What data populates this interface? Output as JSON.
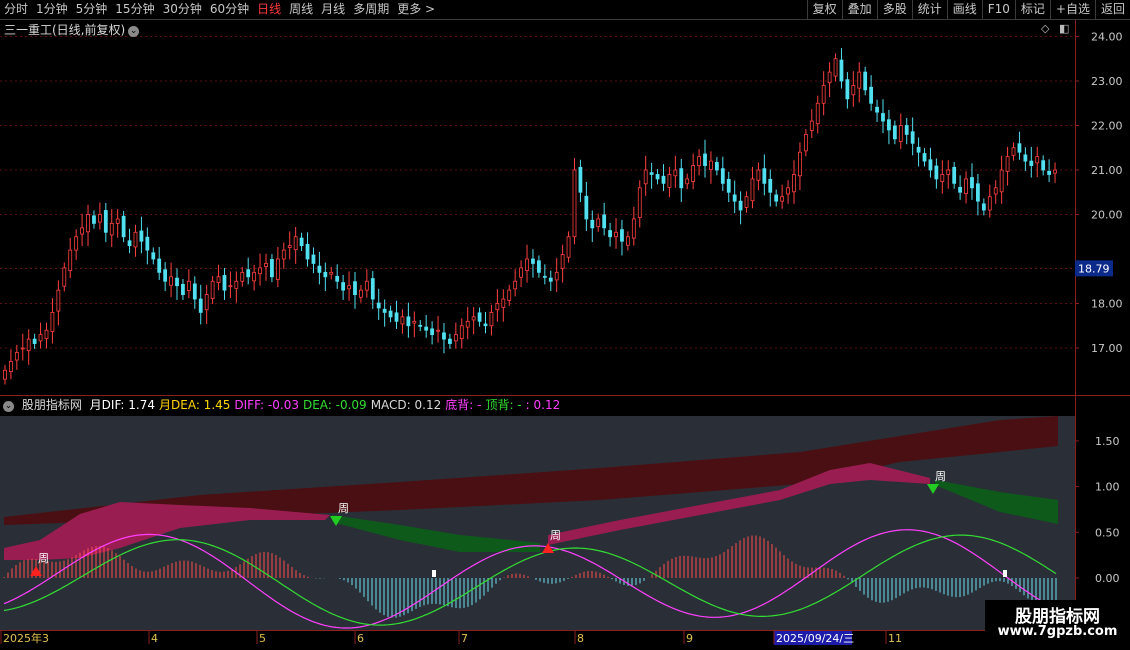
{
  "toolbar": {
    "periods": [
      "分时",
      "1分钟",
      "5分钟",
      "15分钟",
      "30分钟",
      "60分钟",
      "日线",
      "周线",
      "月线",
      "多周期",
      "更多 >"
    ],
    "active_index": 6,
    "tools": [
      "复权",
      "叠加",
      "多股",
      "统计",
      "画线",
      "F10",
      "标记",
      "+自选",
      "返回"
    ]
  },
  "stock": {
    "title": "三一重工(日线,前复权)"
  },
  "price_panel": {
    "icons": [
      "diamond-icon",
      "panel-toggle-icon"
    ],
    "current_price": "18.79"
  },
  "macd_panel": {
    "name": "股朋指标网",
    "items": [
      {
        "text": "月DIF: 1.74",
        "color": "#ffffff"
      },
      {
        "text": "月DEA: 1.45",
        "color": "#ffd700"
      },
      {
        "text": "DIFF: -0.03",
        "color": "#ff40ff"
      },
      {
        "text": "DEA: -0.09",
        "color": "#33dd33"
      },
      {
        "text": "MACD: 0.12",
        "color": "#d8d8d8"
      },
      {
        "text": "底背: -",
        "color": "#ff40ff"
      },
      {
        "text": "顶背: -",
        "color": "#33dd33"
      },
      {
        "text": ": 0.12",
        "color": "#ff40ff"
      }
    ],
    "marker_label": "周"
  },
  "date_axis": {
    "labels": [
      "2025年3",
      "4",
      "5",
      "6",
      "7",
      "8",
      "9",
      "2025/09/24/三",
      "11"
    ],
    "highlight_index": 7
  },
  "watermark": {
    "line1": "股朋指标网",
    "line2": "www.7gpzb.com"
  },
  "chart_data": [
    {
      "type": "candlestick",
      "title": "三一重工(日线,前复权)",
      "ylim": [
        16.55,
        24.35
      ],
      "y_ticks": [
        17.0,
        18.0,
        20.0,
        21.0,
        22.0,
        23.0,
        24.0
      ],
      "last_close": 18.79,
      "colors": {
        "up": "#ff4040",
        "down": "#50e0f0"
      },
      "closes": [
        16.5,
        16.7,
        16.9,
        17.0,
        17.2,
        17.1,
        17.3,
        17.4,
        17.8,
        18.3,
        18.8,
        19.2,
        19.5,
        19.7,
        20.0,
        19.8,
        20.0,
        19.6,
        19.8,
        19.9,
        19.5,
        19.3,
        19.6,
        19.4,
        19.2,
        19.0,
        18.7,
        18.5,
        18.6,
        18.4,
        18.2,
        18.5,
        18.1,
        17.8,
        18.2,
        18.5,
        18.6,
        18.3,
        18.4,
        18.5,
        18.7,
        18.6,
        18.7,
        18.8,
        18.9,
        18.6,
        19.0,
        19.2,
        19.3,
        19.5,
        19.3,
        19.0,
        18.9,
        18.7,
        18.6,
        18.7,
        18.5,
        18.3,
        18.4,
        18.2,
        18.3,
        18.5,
        18.1,
        17.9,
        17.8,
        17.7,
        17.6,
        17.7,
        17.5,
        17.6,
        17.5,
        17.4,
        17.3,
        17.4,
        17.2,
        17.1,
        17.3,
        17.5,
        17.6,
        17.7,
        17.6,
        17.5,
        17.8,
        18.0,
        18.1,
        18.3,
        18.5,
        18.8,
        19.0,
        18.9,
        18.7,
        18.6,
        18.5,
        18.7,
        19.1,
        19.5,
        21.0,
        20.5,
        19.9,
        19.7,
        19.9,
        19.7,
        19.5,
        19.6,
        19.4,
        19.5,
        19.9,
        20.6,
        21.0,
        20.9,
        20.8,
        20.7,
        20.9,
        21.0,
        20.6,
        20.8,
        21.1,
        21.3,
        21.1,
        21.2,
        21.0,
        20.7,
        20.5,
        20.3,
        20.1,
        20.4,
        20.8,
        21.0,
        20.7,
        20.5,
        20.3,
        20.4,
        20.6,
        20.9,
        21.4,
        21.8,
        22.1,
        22.5,
        22.9,
        23.2,
        23.5,
        23.0,
        22.6,
        22.9,
        23.2,
        22.8,
        22.5,
        22.3,
        22.1,
        21.9,
        21.7,
        22.0,
        21.8,
        21.6,
        21.4,
        21.2,
        21.0,
        20.8,
        20.9,
        21.0,
        20.7,
        20.5,
        20.8,
        20.6,
        20.3,
        20.1,
        20.4,
        20.6,
        21.0,
        21.3,
        21.5,
        21.4,
        21.2,
        21.1,
        21.3,
        21.0,
        20.9,
        21.0
      ]
    },
    {
      "type": "macd",
      "ylim": [
        -0.45,
        1.78
      ],
      "y_ticks": [
        0.0,
        0.5,
        1.0,
        1.5
      ],
      "series": [
        {
          "name": "月DIF",
          "last": 1.74
        },
        {
          "name": "月DEA",
          "last": 1.45
        },
        {
          "name": "DIFF",
          "last": -0.03
        },
        {
          "name": "DEA",
          "last": -0.09
        },
        {
          "name": "MACD",
          "last": 0.12
        }
      ]
    }
  ]
}
